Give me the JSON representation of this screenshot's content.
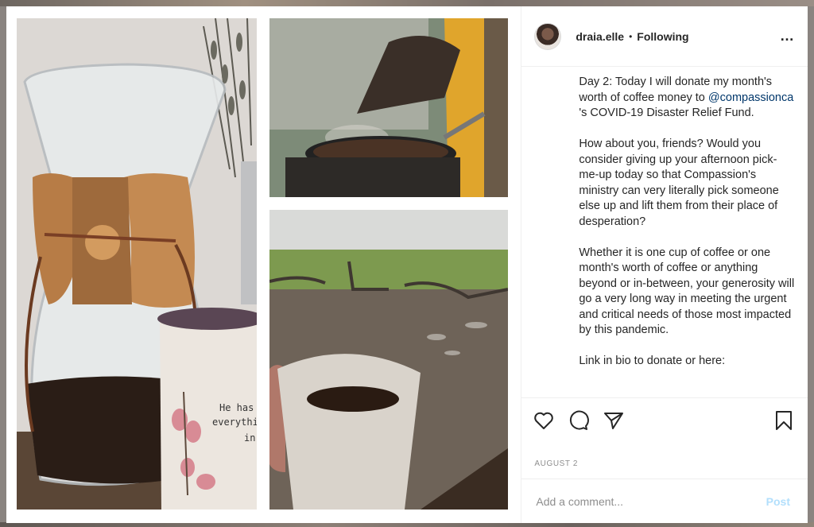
{
  "post": {
    "username": "draia.elle",
    "separator": "•",
    "follow_status": "Following",
    "more_icon": "…",
    "caption": [
      {
        "before": "Day 2: Today I will donate my month's worth of coffee money to ",
        "mention": "@compassionca",
        "after": " 's COVID-19 Disaster Relief Fund."
      },
      {
        "before": "How about you, friends? Would you consider giving up your afternoon pick-me-up today so that Compassion's ministry can very literally pick someone else up and lift them from their place of desperation?",
        "mention": "",
        "after": ""
      },
      {
        "before": "Whether it is one cup of coffee or one month's worth of coffee or anything beyond or in-between, your generosity will go a very long way in meeting the urgent and critical needs of those most impacted by this pandemic.",
        "mention": "",
        "after": ""
      },
      {
        "before": "Link in bio to donate or here:",
        "mention": "",
        "after": ""
      }
    ],
    "date": "AUGUST 2",
    "comment_placeholder": "Add a comment...",
    "post_label": "Post"
  },
  "icons": {
    "like": "heart-icon",
    "comment": "comment-icon",
    "share": "paper-plane-icon",
    "save": "bookmark-icon"
  }
}
